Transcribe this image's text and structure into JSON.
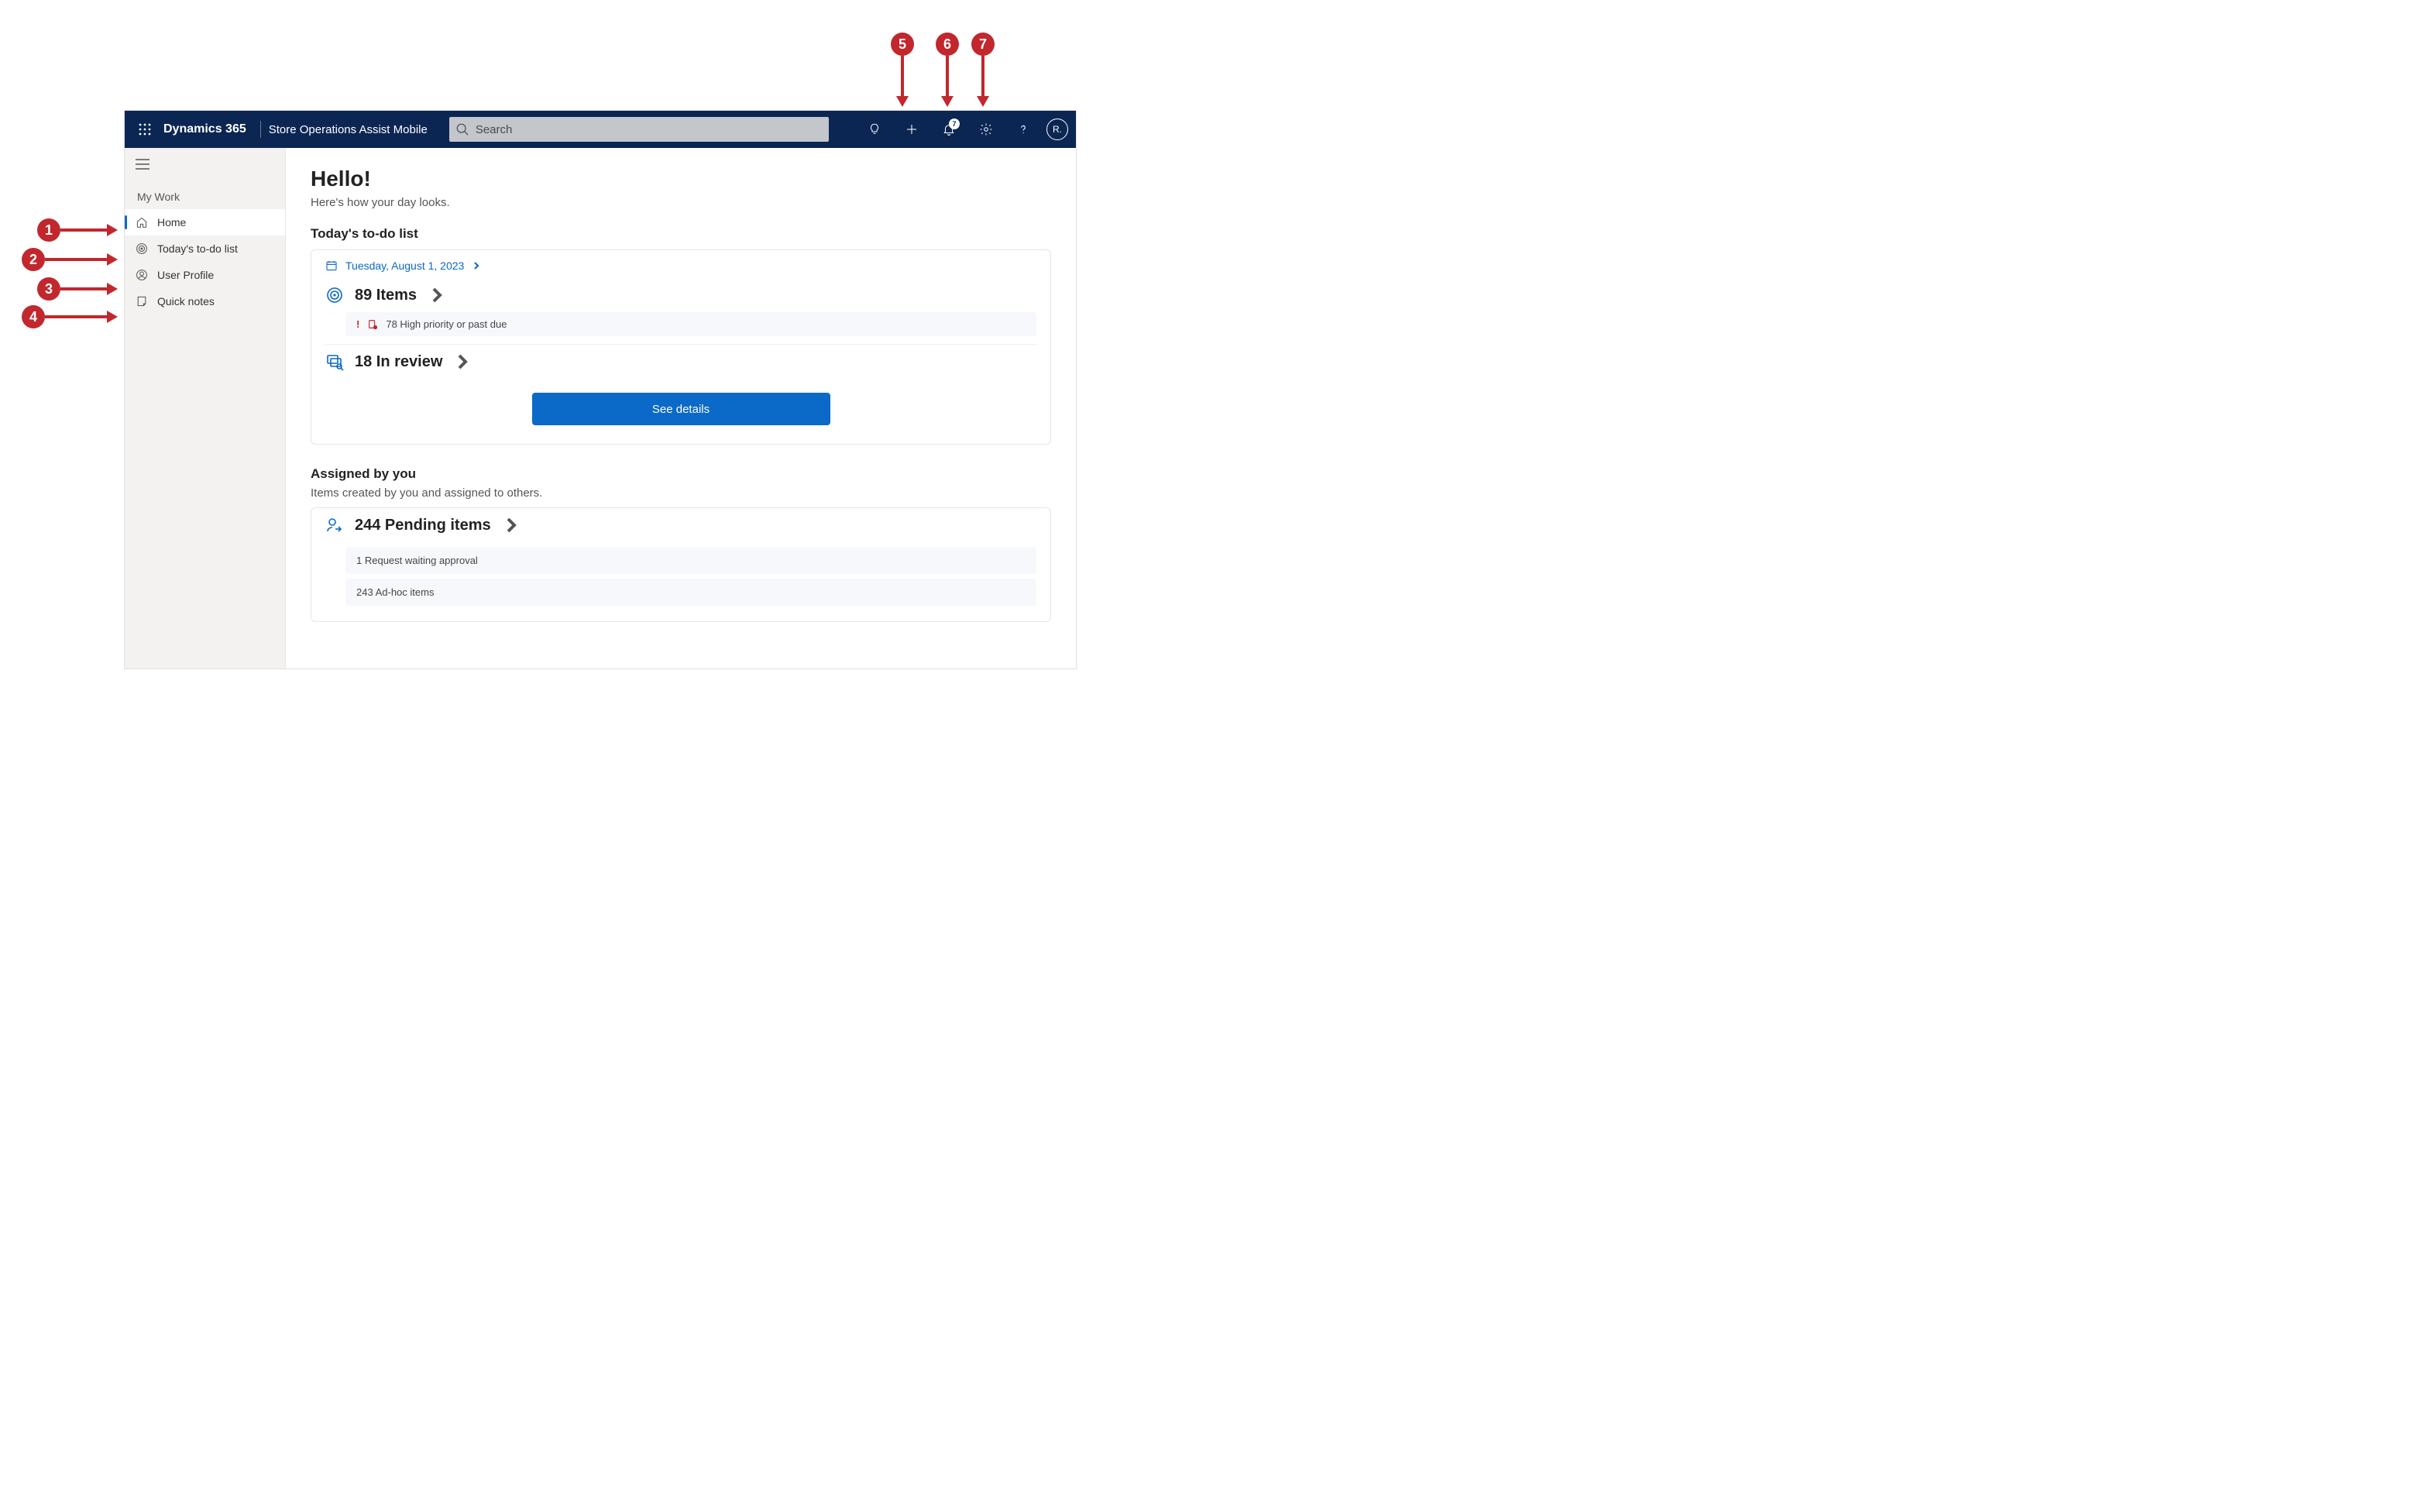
{
  "annotations": {
    "c1": "1",
    "c2": "2",
    "c3": "3",
    "c4": "4",
    "c5": "5",
    "c6": "6",
    "c7": "7"
  },
  "topbar": {
    "brand": "Dynamics 365",
    "app_name": "Store Operations Assist Mobile",
    "search_placeholder": "Search",
    "notification_count": "7",
    "avatar_initial": "R."
  },
  "sidebar": {
    "section": "My Work",
    "items": [
      {
        "label": "Home"
      },
      {
        "label": "Today's to-do list"
      },
      {
        "label": "User Profile"
      },
      {
        "label": "Quick notes"
      }
    ]
  },
  "main": {
    "hello": "Hello!",
    "subtitle": "Here's how your day looks.",
    "todo": {
      "title": "Today's to-do list",
      "date": "Tuesday, August 1, 2023",
      "items_label": "89 Items",
      "priority_notice": "78 High priority or past due",
      "in_review_label": "18 In review",
      "see_details": "See details"
    },
    "assigned": {
      "title": "Assigned by you",
      "subtitle": "Items created by you and assigned to others.",
      "pending_label": "244 Pending items",
      "row1": "1 Request waiting approval",
      "row2": "243 Ad-hoc items"
    }
  }
}
